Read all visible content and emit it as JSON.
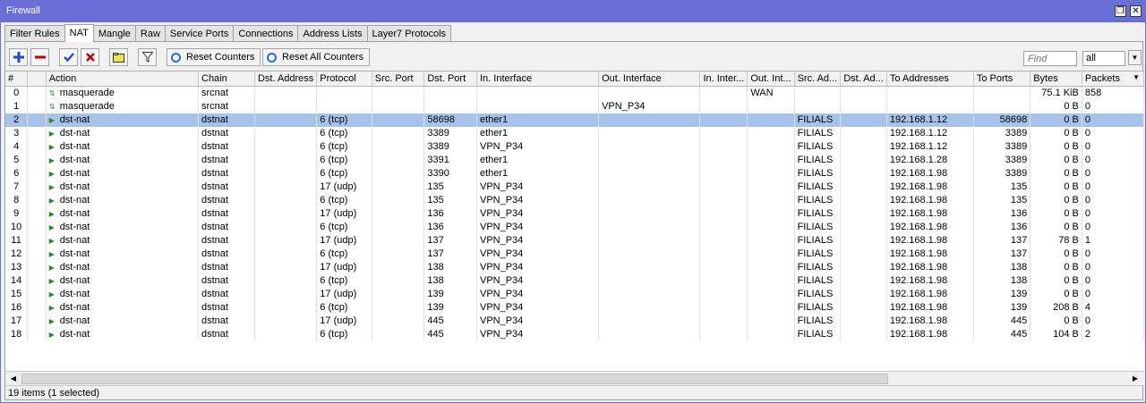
{
  "window": {
    "title": "Firewall",
    "restore_glyph": "❐",
    "close_glyph": "✕"
  },
  "tabs": [
    {
      "label": "Filter Rules",
      "active": false
    },
    {
      "label": "NAT",
      "active": true
    },
    {
      "label": "Mangle",
      "active": false
    },
    {
      "label": "Raw",
      "active": false
    },
    {
      "label": "Service Ports",
      "active": false
    },
    {
      "label": "Connections",
      "active": false
    },
    {
      "label": "Address Lists",
      "active": false
    },
    {
      "label": "Layer7 Protocols",
      "active": false
    }
  ],
  "toolbar": {
    "reset_counters_label": "Reset Counters",
    "reset_all_counters_label": "Reset All Counters",
    "find_placeholder": "Find",
    "filter_value": "all",
    "colors": {
      "add": "#1f4fbf",
      "remove": "#c00000",
      "enable": "#1f4fbf",
      "disable": "#c00000"
    }
  },
  "table": {
    "columns": [
      "#",
      "",
      "Action",
      "Chain",
      "Dst. Address",
      "Protocol",
      "Src. Port",
      "Dst. Port",
      "In. Interface",
      "Out. Interface",
      "In. Inter...",
      "Out. Int...",
      "Src. Ad...",
      "Dst. Ad...",
      "To Addresses",
      "To Ports",
      "Bytes",
      "Packets"
    ],
    "rows": [
      {
        "num": "0",
        "action": "masquerade",
        "chain": "srcnat",
        "proto": "",
        "dport": "",
        "in_if": "",
        "out_if": "",
        "out_int": "WAN",
        "src_ad": "",
        "to_addr": "",
        "to_ports": "",
        "bytes": "75.1 KiB",
        "packets": "858",
        "icon": "masq",
        "selected": false
      },
      {
        "num": "1",
        "action": "masquerade",
        "chain": "srcnat",
        "proto": "",
        "dport": "",
        "in_if": "",
        "out_if": "VPN_P34",
        "out_int": "",
        "src_ad": "",
        "to_addr": "",
        "to_ports": "",
        "bytes": "0 B",
        "packets": "0",
        "icon": "masq",
        "selected": false
      },
      {
        "num": "2",
        "action": "dst-nat",
        "chain": "dstnat",
        "proto": "6 (tcp)",
        "dport": "58698",
        "in_if": "ether1",
        "out_if": "",
        "out_int": "",
        "src_ad": "FILIALS",
        "to_addr": "192.168.1.12",
        "to_ports": "58698",
        "bytes": "0 B",
        "packets": "0",
        "icon": "dst",
        "selected": true
      },
      {
        "num": "3",
        "action": "dst-nat",
        "chain": "dstnat",
        "proto": "6 (tcp)",
        "dport": "3389",
        "in_if": "ether1",
        "out_if": "",
        "out_int": "",
        "src_ad": "FILIALS",
        "to_addr": "192.168.1.12",
        "to_ports": "3389",
        "bytes": "0 B",
        "packets": "0",
        "icon": "dst",
        "selected": false
      },
      {
        "num": "4",
        "action": "dst-nat",
        "chain": "dstnat",
        "proto": "6 (tcp)",
        "dport": "3389",
        "in_if": "VPN_P34",
        "out_if": "",
        "out_int": "",
        "src_ad": "FILIALS",
        "to_addr": "192.168.1.12",
        "to_ports": "3389",
        "bytes": "0 B",
        "packets": "0",
        "icon": "dst",
        "selected": false
      },
      {
        "num": "5",
        "action": "dst-nat",
        "chain": "dstnat",
        "proto": "6 (tcp)",
        "dport": "3391",
        "in_if": "ether1",
        "out_if": "",
        "out_int": "",
        "src_ad": "FILIALS",
        "to_addr": "192.168.1.28",
        "to_ports": "3389",
        "bytes": "0 B",
        "packets": "0",
        "icon": "dst",
        "selected": false
      },
      {
        "num": "6",
        "action": "dst-nat",
        "chain": "dstnat",
        "proto": "6 (tcp)",
        "dport": "3390",
        "in_if": "ether1",
        "out_if": "",
        "out_int": "",
        "src_ad": "FILIALS",
        "to_addr": "192.168.1.98",
        "to_ports": "3389",
        "bytes": "0 B",
        "packets": "0",
        "icon": "dst",
        "selected": false
      },
      {
        "num": "7",
        "action": "dst-nat",
        "chain": "dstnat",
        "proto": "17 (udp)",
        "dport": "135",
        "in_if": "VPN_P34",
        "out_if": "",
        "out_int": "",
        "src_ad": "FILIALS",
        "to_addr": "192.168.1.98",
        "to_ports": "135",
        "bytes": "0 B",
        "packets": "0",
        "icon": "dst",
        "selected": false
      },
      {
        "num": "8",
        "action": "dst-nat",
        "chain": "dstnat",
        "proto": "6 (tcp)",
        "dport": "135",
        "in_if": "VPN_P34",
        "out_if": "",
        "out_int": "",
        "src_ad": "FILIALS",
        "to_addr": "192.168.1.98",
        "to_ports": "135",
        "bytes": "0 B",
        "packets": "0",
        "icon": "dst",
        "selected": false
      },
      {
        "num": "9",
        "action": "dst-nat",
        "chain": "dstnat",
        "proto": "17 (udp)",
        "dport": "136",
        "in_if": "VPN_P34",
        "out_if": "",
        "out_int": "",
        "src_ad": "FILIALS",
        "to_addr": "192.168.1.98",
        "to_ports": "136",
        "bytes": "0 B",
        "packets": "0",
        "icon": "dst",
        "selected": false
      },
      {
        "num": "10",
        "action": "dst-nat",
        "chain": "dstnat",
        "proto": "6 (tcp)",
        "dport": "136",
        "in_if": "VPN_P34",
        "out_if": "",
        "out_int": "",
        "src_ad": "FILIALS",
        "to_addr": "192.168.1.98",
        "to_ports": "136",
        "bytes": "0 B",
        "packets": "0",
        "icon": "dst",
        "selected": false
      },
      {
        "num": "11",
        "action": "dst-nat",
        "chain": "dstnat",
        "proto": "17 (udp)",
        "dport": "137",
        "in_if": "VPN_P34",
        "out_if": "",
        "out_int": "",
        "src_ad": "FILIALS",
        "to_addr": "192.168.1.98",
        "to_ports": "137",
        "bytes": "78 B",
        "packets": "1",
        "icon": "dst",
        "selected": false
      },
      {
        "num": "12",
        "action": "dst-nat",
        "chain": "dstnat",
        "proto": "6 (tcp)",
        "dport": "137",
        "in_if": "VPN_P34",
        "out_if": "",
        "out_int": "",
        "src_ad": "FILIALS",
        "to_addr": "192.168.1.98",
        "to_ports": "137",
        "bytes": "0 B",
        "packets": "0",
        "icon": "dst",
        "selected": false
      },
      {
        "num": "13",
        "action": "dst-nat",
        "chain": "dstnat",
        "proto": "17 (udp)",
        "dport": "138",
        "in_if": "VPN_P34",
        "out_if": "",
        "out_int": "",
        "src_ad": "FILIALS",
        "to_addr": "192.168.1.98",
        "to_ports": "138",
        "bytes": "0 B",
        "packets": "0",
        "icon": "dst",
        "selected": false
      },
      {
        "num": "14",
        "action": "dst-nat",
        "chain": "dstnat",
        "proto": "6 (tcp)",
        "dport": "138",
        "in_if": "VPN_P34",
        "out_if": "",
        "out_int": "",
        "src_ad": "FILIALS",
        "to_addr": "192.168.1.98",
        "to_ports": "138",
        "bytes": "0 B",
        "packets": "0",
        "icon": "dst",
        "selected": false
      },
      {
        "num": "15",
        "action": "dst-nat",
        "chain": "dstnat",
        "proto": "17 (udp)",
        "dport": "139",
        "in_if": "VPN_P34",
        "out_if": "",
        "out_int": "",
        "src_ad": "FILIALS",
        "to_addr": "192.168.1.98",
        "to_ports": "139",
        "bytes": "0 B",
        "packets": "0",
        "icon": "dst",
        "selected": false
      },
      {
        "num": "16",
        "action": "dst-nat",
        "chain": "dstnat",
        "proto": "6 (tcp)",
        "dport": "139",
        "in_if": "VPN_P34",
        "out_if": "",
        "out_int": "",
        "src_ad": "FILIALS",
        "to_addr": "192.168.1.98",
        "to_ports": "139",
        "bytes": "208 B",
        "packets": "4",
        "icon": "dst",
        "selected": false
      },
      {
        "num": "17",
        "action": "dst-nat",
        "chain": "dstnat",
        "proto": "17 (udp)",
        "dport": "445",
        "in_if": "VPN_P34",
        "out_if": "",
        "out_int": "",
        "src_ad": "FILIALS",
        "to_addr": "192.168.1.98",
        "to_ports": "445",
        "bytes": "0 B",
        "packets": "0",
        "icon": "dst",
        "selected": false
      },
      {
        "num": "18",
        "action": "dst-nat",
        "chain": "dstnat",
        "proto": "6 (tcp)",
        "dport": "445",
        "in_if": "VPN_P34",
        "out_if": "",
        "out_int": "",
        "src_ad": "FILIALS",
        "to_addr": "192.168.1.98",
        "to_ports": "445",
        "bytes": "104 B",
        "packets": "2",
        "icon": "dst",
        "selected": false
      }
    ]
  },
  "status": {
    "text": "19 items (1 selected)"
  }
}
